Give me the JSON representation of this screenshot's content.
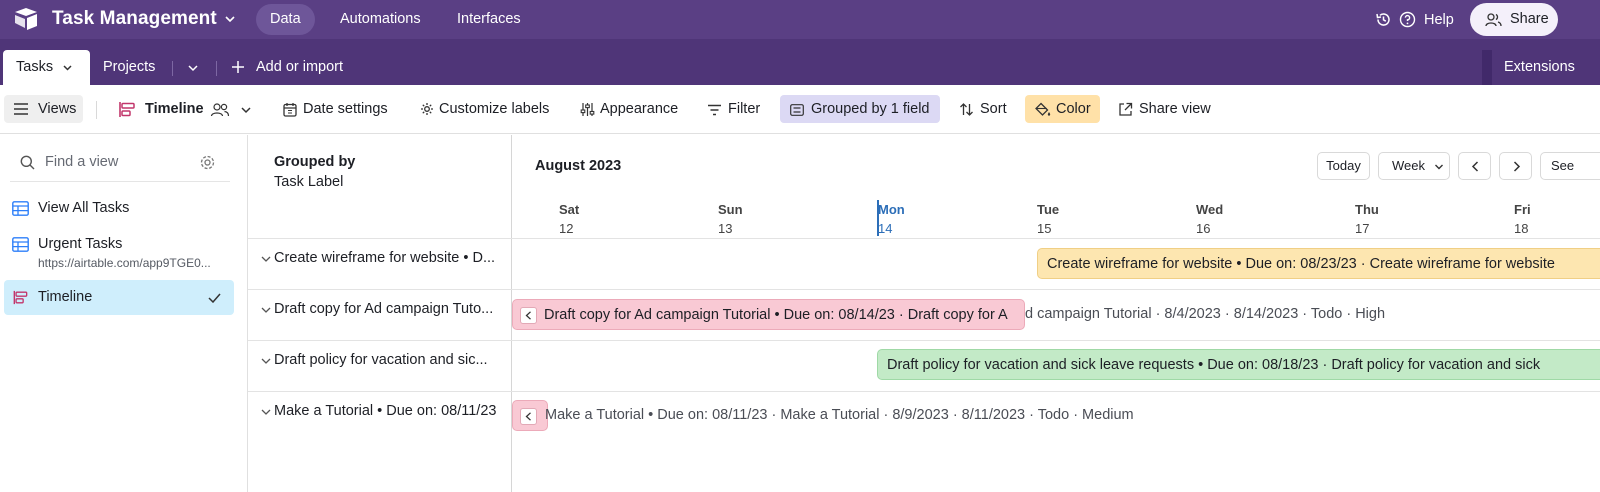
{
  "app": {
    "base_title": "Task Management",
    "nav": [
      "Data",
      "Automations",
      "Interfaces"
    ],
    "help": "Help",
    "share": "Share"
  },
  "tables": {
    "active": "Tasks",
    "other": "Projects",
    "add": "Add or import",
    "extensions": "Extensions"
  },
  "viewbar": {
    "views": "Views",
    "view_name": "Timeline",
    "date_settings": "Date settings",
    "customize_labels": "Customize labels",
    "appearance": "Appearance",
    "filter": "Filter",
    "grouped": "Grouped by 1 field",
    "sort": "Sort",
    "color": "Color",
    "share_view": "Share view"
  },
  "sidebar": {
    "find_placeholder": "Find a view",
    "views": [
      {
        "label": "View All Tasks",
        "icon": "grid-icon"
      },
      {
        "label": "Urgent Tasks",
        "sub": "https://airtable.com/app9TGE0...",
        "icon": "grid-icon"
      },
      {
        "label": "Timeline",
        "icon": "timeline-icon",
        "selected": true
      }
    ]
  },
  "groups": {
    "title": "Grouped by",
    "field": "Task Label",
    "rows": [
      "Create wireframe for website • D...",
      "Draft copy for Ad campaign Tuto...",
      "Draft policy for vacation and sic...",
      "Make a Tutorial • Due on: 08/11/23"
    ]
  },
  "timeline": {
    "month": "August 2023",
    "today": "Today",
    "scale": "Week",
    "see": "See",
    "days": [
      {
        "name": "Sat",
        "num": "12"
      },
      {
        "name": "Sun",
        "num": "13"
      },
      {
        "name": "Mon",
        "num": "14",
        "today": true
      },
      {
        "name": "Tue",
        "num": "15"
      },
      {
        "name": "Wed",
        "num": "16"
      },
      {
        "name": "Thu",
        "num": "17"
      },
      {
        "name": "Fri",
        "num": "18"
      }
    ],
    "bars": [
      {
        "text": "Create wireframe for website • Due on: 08/23/23 · Create wireframe for website",
        "color": "#fde6b0"
      },
      {
        "text": "Draft copy for Ad campaign Tutorial • Due on: 08/14/23 · Draft copy for A",
        "overflow": "d campaign Tutorial · 8/4/2023 · 8/14/2023 · Todo · High",
        "color": "#f9c9d4"
      },
      {
        "text": "Draft policy for vacation and sick leave requests • Due on: 08/18/23 · Draft policy for vacation and sick",
        "color": "#c3eac7"
      },
      {
        "text": "",
        "overflow": "Make a Tutorial • Due on: 08/11/23 · Make a Tutorial · 8/9/2023 · 8/11/2023 · Todo · Medium",
        "color": "#f9c9d4"
      }
    ]
  },
  "colors": {
    "topbar": "#5a3f84",
    "tabbar": "#4f3578",
    "today_accent": "#2c6eb8",
    "grouped_bg": "#dcd9f4",
    "color_btn_bg": "#ffe1a8",
    "selected_view_bg": "#cfeefc"
  }
}
